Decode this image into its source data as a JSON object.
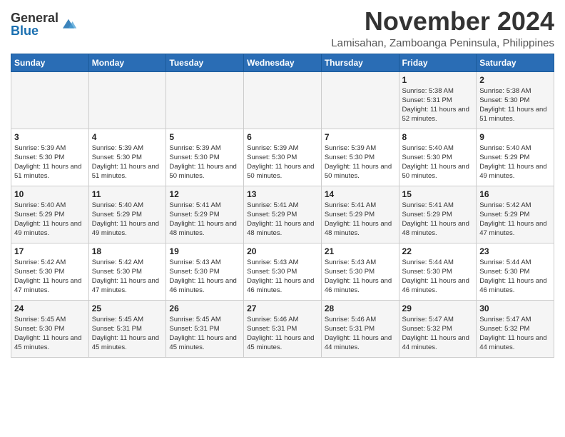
{
  "header": {
    "logo_general": "General",
    "logo_blue": "Blue",
    "month_title": "November 2024",
    "subtitle": "Lamisahan, Zamboanga Peninsula, Philippines"
  },
  "days_of_week": [
    "Sunday",
    "Monday",
    "Tuesday",
    "Wednesday",
    "Thursday",
    "Friday",
    "Saturday"
  ],
  "weeks": [
    [
      {
        "day": "",
        "info": ""
      },
      {
        "day": "",
        "info": ""
      },
      {
        "day": "",
        "info": ""
      },
      {
        "day": "",
        "info": ""
      },
      {
        "day": "",
        "info": ""
      },
      {
        "day": "1",
        "info": "Sunrise: 5:38 AM\nSunset: 5:31 PM\nDaylight: 11 hours and 52 minutes."
      },
      {
        "day": "2",
        "info": "Sunrise: 5:38 AM\nSunset: 5:30 PM\nDaylight: 11 hours and 51 minutes."
      }
    ],
    [
      {
        "day": "3",
        "info": "Sunrise: 5:39 AM\nSunset: 5:30 PM\nDaylight: 11 hours and 51 minutes."
      },
      {
        "day": "4",
        "info": "Sunrise: 5:39 AM\nSunset: 5:30 PM\nDaylight: 11 hours and 51 minutes."
      },
      {
        "day": "5",
        "info": "Sunrise: 5:39 AM\nSunset: 5:30 PM\nDaylight: 11 hours and 50 minutes."
      },
      {
        "day": "6",
        "info": "Sunrise: 5:39 AM\nSunset: 5:30 PM\nDaylight: 11 hours and 50 minutes."
      },
      {
        "day": "7",
        "info": "Sunrise: 5:39 AM\nSunset: 5:30 PM\nDaylight: 11 hours and 50 minutes."
      },
      {
        "day": "8",
        "info": "Sunrise: 5:40 AM\nSunset: 5:30 PM\nDaylight: 11 hours and 50 minutes."
      },
      {
        "day": "9",
        "info": "Sunrise: 5:40 AM\nSunset: 5:29 PM\nDaylight: 11 hours and 49 minutes."
      }
    ],
    [
      {
        "day": "10",
        "info": "Sunrise: 5:40 AM\nSunset: 5:29 PM\nDaylight: 11 hours and 49 minutes."
      },
      {
        "day": "11",
        "info": "Sunrise: 5:40 AM\nSunset: 5:29 PM\nDaylight: 11 hours and 49 minutes."
      },
      {
        "day": "12",
        "info": "Sunrise: 5:41 AM\nSunset: 5:29 PM\nDaylight: 11 hours and 48 minutes."
      },
      {
        "day": "13",
        "info": "Sunrise: 5:41 AM\nSunset: 5:29 PM\nDaylight: 11 hours and 48 minutes."
      },
      {
        "day": "14",
        "info": "Sunrise: 5:41 AM\nSunset: 5:29 PM\nDaylight: 11 hours and 48 minutes."
      },
      {
        "day": "15",
        "info": "Sunrise: 5:41 AM\nSunset: 5:29 PM\nDaylight: 11 hours and 48 minutes."
      },
      {
        "day": "16",
        "info": "Sunrise: 5:42 AM\nSunset: 5:29 PM\nDaylight: 11 hours and 47 minutes."
      }
    ],
    [
      {
        "day": "17",
        "info": "Sunrise: 5:42 AM\nSunset: 5:30 PM\nDaylight: 11 hours and 47 minutes."
      },
      {
        "day": "18",
        "info": "Sunrise: 5:42 AM\nSunset: 5:30 PM\nDaylight: 11 hours and 47 minutes."
      },
      {
        "day": "19",
        "info": "Sunrise: 5:43 AM\nSunset: 5:30 PM\nDaylight: 11 hours and 46 minutes."
      },
      {
        "day": "20",
        "info": "Sunrise: 5:43 AM\nSunset: 5:30 PM\nDaylight: 11 hours and 46 minutes."
      },
      {
        "day": "21",
        "info": "Sunrise: 5:43 AM\nSunset: 5:30 PM\nDaylight: 11 hours and 46 minutes."
      },
      {
        "day": "22",
        "info": "Sunrise: 5:44 AM\nSunset: 5:30 PM\nDaylight: 11 hours and 46 minutes."
      },
      {
        "day": "23",
        "info": "Sunrise: 5:44 AM\nSunset: 5:30 PM\nDaylight: 11 hours and 46 minutes."
      }
    ],
    [
      {
        "day": "24",
        "info": "Sunrise: 5:45 AM\nSunset: 5:30 PM\nDaylight: 11 hours and 45 minutes."
      },
      {
        "day": "25",
        "info": "Sunrise: 5:45 AM\nSunset: 5:31 PM\nDaylight: 11 hours and 45 minutes."
      },
      {
        "day": "26",
        "info": "Sunrise: 5:45 AM\nSunset: 5:31 PM\nDaylight: 11 hours and 45 minutes."
      },
      {
        "day": "27",
        "info": "Sunrise: 5:46 AM\nSunset: 5:31 PM\nDaylight: 11 hours and 45 minutes."
      },
      {
        "day": "28",
        "info": "Sunrise: 5:46 AM\nSunset: 5:31 PM\nDaylight: 11 hours and 44 minutes."
      },
      {
        "day": "29",
        "info": "Sunrise: 5:47 AM\nSunset: 5:32 PM\nDaylight: 11 hours and 44 minutes."
      },
      {
        "day": "30",
        "info": "Sunrise: 5:47 AM\nSunset: 5:32 PM\nDaylight: 11 hours and 44 minutes."
      }
    ]
  ]
}
